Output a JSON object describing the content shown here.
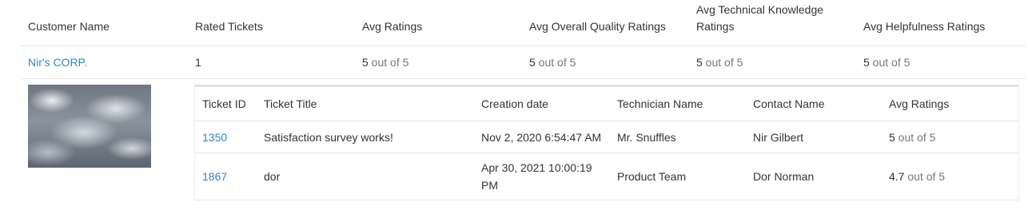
{
  "customers_table": {
    "headers": {
      "customer_name": "Customer Name",
      "rated_tickets": "Rated Tickets",
      "avg_ratings": "Avg Ratings",
      "avg_overall_quality": "Avg Overall Quality Ratings",
      "avg_technical_knowledge": "Avg Technical Knowledge Ratings",
      "avg_helpfulness": "Avg Helpfulness Ratings"
    },
    "row": {
      "customer_name": "Nir's CORP.",
      "rated_tickets": "1",
      "avg_ratings": {
        "value": "5",
        "suffix": " out of 5"
      },
      "avg_overall_quality": {
        "value": "5",
        "suffix": " out of 5"
      },
      "avg_technical_knowledge": {
        "value": "5",
        "suffix": " out of 5"
      },
      "avg_helpfulness": {
        "value": "5",
        "suffix": " out of 5"
      }
    }
  },
  "tickets_table": {
    "headers": {
      "ticket_id": "Ticket ID",
      "ticket_title": "Ticket Title",
      "creation_date": "Creation date",
      "technician_name": "Technician Name",
      "contact_name": "Contact Name",
      "avg_ratings": "Avg Ratings"
    },
    "rows": [
      {
        "ticket_id": "1350",
        "ticket_title": "Satisfaction survey works!",
        "creation_date": "Nov 2, 2020 6:54:47 AM",
        "technician_name": "Mr. Snuffles",
        "contact_name": "Nir Gilbert",
        "avg_rating": {
          "value": "5",
          "suffix": " out of 5"
        }
      },
      {
        "ticket_id": "1867",
        "ticket_title": "dor",
        "creation_date": "Apr 30, 2021 10:00:19 PM",
        "technician_name": "Product Team",
        "contact_name": "Dor Norman",
        "avg_rating": {
          "value": "4.7",
          "suffix": " out of 5"
        }
      }
    ]
  },
  "colors": {
    "link": "#2f87c0",
    "text": "#333333",
    "muted": "#777777",
    "border": "#e6e6e6"
  }
}
